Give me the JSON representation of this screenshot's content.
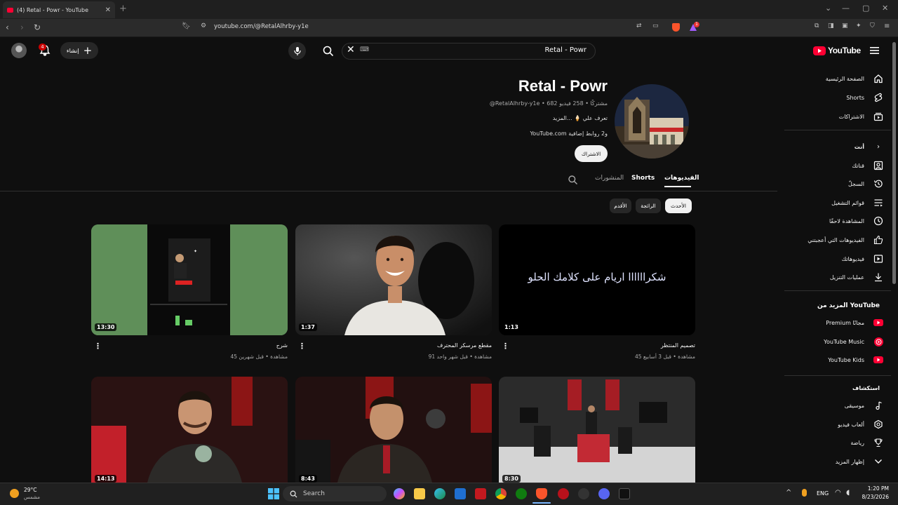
{
  "browser": {
    "tab_title": "(4) Retal - Powr - YouTube",
    "url": "youtube.com/@RetalAlhrby-y1e",
    "ext_badge": "1"
  },
  "topbar": {
    "search_query": "Retal - Powr",
    "search_kbd_hint": "⌨",
    "create_label": "إنشاء",
    "notifications_count": "4"
  },
  "sidebar": {
    "logo_text": "YouTube",
    "main_items": [
      {
        "label": "الصفحة الرئيسية",
        "icon": "home-icon"
      },
      {
        "label": "Shorts",
        "icon": "shorts-icon"
      },
      {
        "label": "الاشتراكات",
        "icon": "subscriptions-icon"
      }
    ],
    "you_header": "أنت",
    "you_items": [
      {
        "label": "قناتك",
        "icon": "channel-icon"
      },
      {
        "label": "السجلّ",
        "icon": "history-icon"
      },
      {
        "label": "قوائم التشغيل",
        "icon": "playlists-icon"
      },
      {
        "label": "المشاهدة لاحقًا",
        "icon": "watch-later-icon"
      },
      {
        "label": "الفيديوهات التي أعجبتني",
        "icon": "like-icon"
      },
      {
        "label": "فيديوهاتك",
        "icon": "your-videos-icon"
      },
      {
        "label": "عمليات التنزيل",
        "icon": "download-icon"
      }
    ],
    "more_header": "المزيد من YouTube",
    "more_items": [
      {
        "label": "Premium مجانًا",
        "icon": "premium-icon"
      },
      {
        "label": "YouTube Music",
        "icon": "music-icon"
      },
      {
        "label": "YouTube Kids",
        "icon": "kids-icon"
      }
    ],
    "explore_header": "استكشاف",
    "explore_items": [
      {
        "label": "موسيقى",
        "icon": "music-note-icon"
      },
      {
        "label": "ألعاب فيديو",
        "icon": "gaming-icon"
      },
      {
        "label": "رياضة",
        "icon": "trophy-icon"
      },
      {
        "label": "إظهار المزيد",
        "icon": "chevron-down-icon"
      }
    ]
  },
  "channel": {
    "name": "Retal - Powr",
    "handle_line": "@RetalAlhrby-y1e • 682 مشتركًا • 258 فيديو",
    "about_line": "تعرف علي 🍦 ...المزيد",
    "links_line": "YouTube.com و2 روابط إضافية",
    "subscribe_label": "الاشتراك"
  },
  "tabs": [
    {
      "label": "الفيديوهات",
      "active": true
    },
    {
      "label": "Shorts",
      "active": false
    },
    {
      "label": "المنشورات",
      "active": false
    }
  ],
  "chips": [
    {
      "label": "الأحدث",
      "active": true
    },
    {
      "label": "الرائجة",
      "active": false
    },
    {
      "label": "الأقدم",
      "active": false
    }
  ],
  "videos": [
    {
      "title": "تصميم المنتظر",
      "meta": "45 مشاهدة • قبل 3 أسابيع",
      "duration": "1:13",
      "thumb_text": "شكراااااا اريام على كلامك الحلو"
    },
    {
      "title": "مقطع مرسكر المحترف",
      "meta": "91 مشاهدة • قبل شهر واحد",
      "duration": "1:37"
    },
    {
      "title": "شرح",
      "meta": "45 مشاهدة • قبل شهرين",
      "duration": "13:30"
    },
    {
      "title": "",
      "meta": "",
      "duration": "8:30"
    },
    {
      "title": "",
      "meta": "",
      "duration": "8:43"
    },
    {
      "title": "",
      "meta": "",
      "duration": "14:13"
    }
  ],
  "taskbar": {
    "weather_temp": "29°C",
    "weather_desc": "مشمس",
    "search_label": "Search",
    "lang": "ENG",
    "time": "1:20 PM",
    "date": "8/23/2026"
  },
  "colors": {
    "youtube_red": "#ff0033",
    "background": "#0f0f0f",
    "link_blue": "#3ea6ff"
  }
}
